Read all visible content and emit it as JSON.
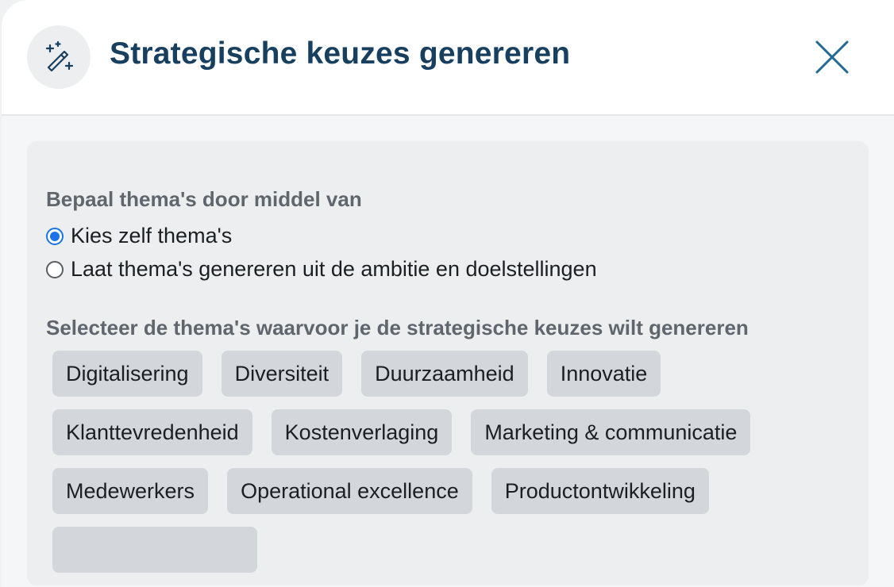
{
  "modal": {
    "title": "Strategische keuzes genereren",
    "icon": "magic-wand-icon",
    "close_icon": "close-icon"
  },
  "theme_source": {
    "label": "Bepaal thema's door middel van",
    "options": [
      {
        "label": "Kies zelf thema's",
        "checked": true
      },
      {
        "label": "Laat thema's genereren uit de ambitie en doelstellingen",
        "checked": false
      }
    ]
  },
  "themes": {
    "label": "Selecteer de thema's waarvoor je de strategische keuzes wilt genereren",
    "rows": [
      [
        "Digitalisering",
        "Diversiteit",
        "Duurzaamheid",
        "Innovatie"
      ],
      [
        "Klanttevredenheid",
        "Kostenverlaging",
        "Marketing & communicatie"
      ],
      [
        "Medewerkers",
        "Operational excellence",
        "Productontwikkeling"
      ]
    ]
  },
  "colors": {
    "title": "#173f5f",
    "radio_accent": "#1a73e8",
    "chip_bg": "#d3d7db",
    "panel_bg": "#edeef0"
  }
}
